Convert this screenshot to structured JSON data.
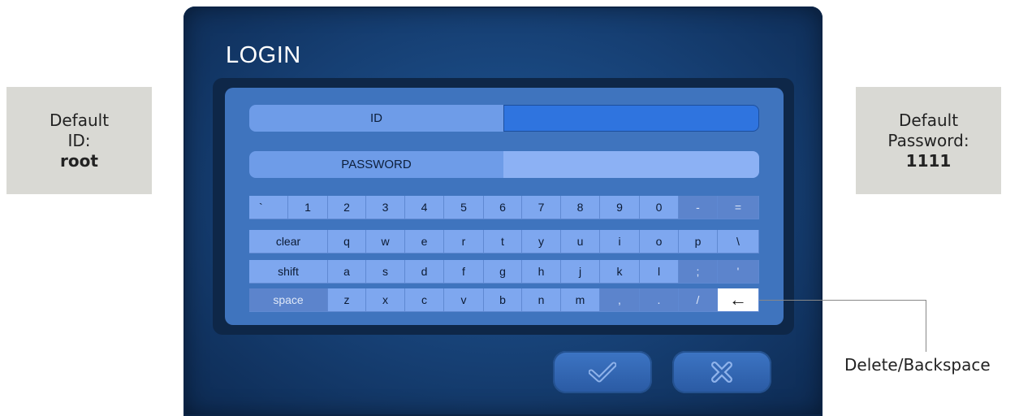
{
  "annotations": {
    "default_id": {
      "line1": "Default",
      "line2": "ID:",
      "value": "root"
    },
    "default_password": {
      "line1": "Default",
      "line2": "Password:",
      "value": "1111"
    },
    "backspace_label": "Delete/Backspace"
  },
  "dialog": {
    "title": "LOGIN",
    "id_label": "ID",
    "id_value": "",
    "password_label": "PASSWORD",
    "password_value": "",
    "ok_icon": "checkmark-icon",
    "cancel_icon": "close-x-icon"
  },
  "keyboard": {
    "row1": [
      "`",
      "1",
      "2",
      "3",
      "4",
      "5",
      "6",
      "7",
      "8",
      "9",
      "0",
      "-",
      "="
    ],
    "row2": [
      "clear",
      "q",
      "w",
      "e",
      "r",
      "t",
      "y",
      "u",
      "i",
      "o",
      "p",
      "\\"
    ],
    "row3": [
      "shift",
      "a",
      "s",
      "d",
      "f",
      "g",
      "h",
      "j",
      "k",
      "l",
      ";",
      "'"
    ],
    "row4": [
      "space",
      "z",
      "x",
      "c",
      "v",
      "b",
      "n",
      "m",
      ",",
      ".",
      "/",
      "←"
    ]
  },
  "colors": {
    "dialog_bg": "#163f73",
    "panel_bg": "#3f74be",
    "key_bg": "#7ea7ef",
    "key_dark_bg": "#5c84cc",
    "id_input_bg": "#2f74df",
    "password_input_bg": "#8cb1f4",
    "callout_bg": "#d9d9d4"
  }
}
